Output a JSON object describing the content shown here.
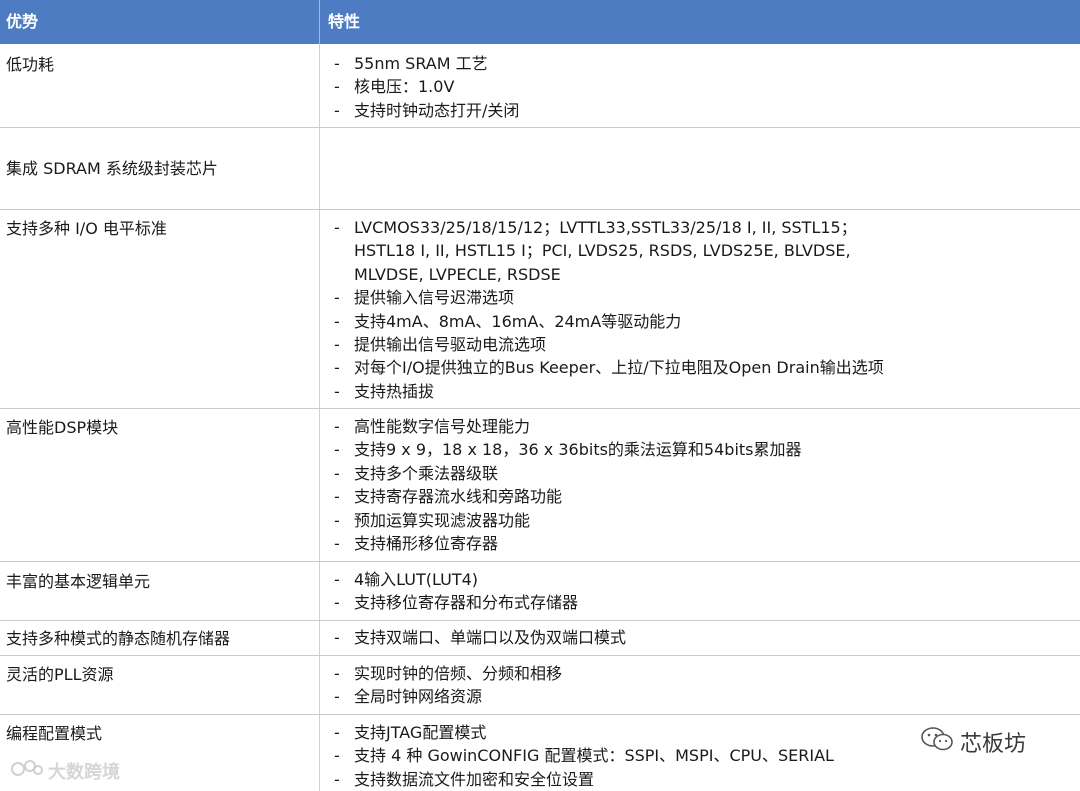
{
  "header": {
    "col1": "优势",
    "col2": "特性"
  },
  "rows": [
    {
      "label": "低功耗",
      "items": [
        "55nm SRAM 工艺",
        "核电压：1.0V",
        "支持时钟动态打开/关闭"
      ]
    },
    {
      "label": "集成 SDRAM 系统级封装芯片",
      "items": []
    },
    {
      "label": "支持多种 I/O 电平标准",
      "items": [
        "LVCMOS33/25/18/15/12；LVTTL33,SSTL33/25/18 I, II, SSTL15；",
        "HSTL18 I, II, HSTL15 I；PCI, LVDS25, RSDS, LVDS25E, BLVDSE,",
        "MLVDSE, LVPECLE, RSDSE",
        "提供输入信号迟滞选项",
        "支持4mA、8mA、16mA、24mA等驱动能力",
        "提供输出信号驱动电流选项",
        "对每个I/O提供独立的Bus Keeper、上拉/下拉电阻及Open Drain输出选项",
        "支持热插拔"
      ]
    },
    {
      "label": "高性能DSP模块",
      "items": [
        "高性能数字信号处理能力",
        "支持9 x 9，18 x 18，36 x 36bits的乘法运算和54bits累加器",
        "支持多个乘法器级联",
        "支持寄存器流水线和旁路功能",
        "预加运算实现滤波器功能",
        "支持桶形移位寄存器"
      ]
    },
    {
      "label": "丰富的基本逻辑单元",
      "items": [
        "4输入LUT(LUT4)",
        "支持移位寄存器和分布式存储器"
      ]
    },
    {
      "label": "支持多种模式的静态随机存储器",
      "items": [
        "支持双端口、单端口以及伪双端口模式"
      ]
    },
    {
      "label": "灵活的PLL资源",
      "items": [
        "实现时钟的倍频、分频和相移",
        "全局时钟网络资源"
      ]
    },
    {
      "label": "编程配置模式",
      "items": [
        "支持JTAG配置模式",
        "支持 4 种 GowinCONFIG 配置模式：SSPI、MSPI、CPU、SERIAL",
        "支持数据流文件加密和安全位设置"
      ]
    }
  ],
  "watermarks": {
    "left": "大数跨境",
    "right": "芯板坊"
  },
  "icons": {
    "left_logo": "logo-icon",
    "right_logo": "wechat-icon"
  },
  "colors": {
    "header_bg": "#4e7cc3",
    "header_text": "#ffffff"
  }
}
